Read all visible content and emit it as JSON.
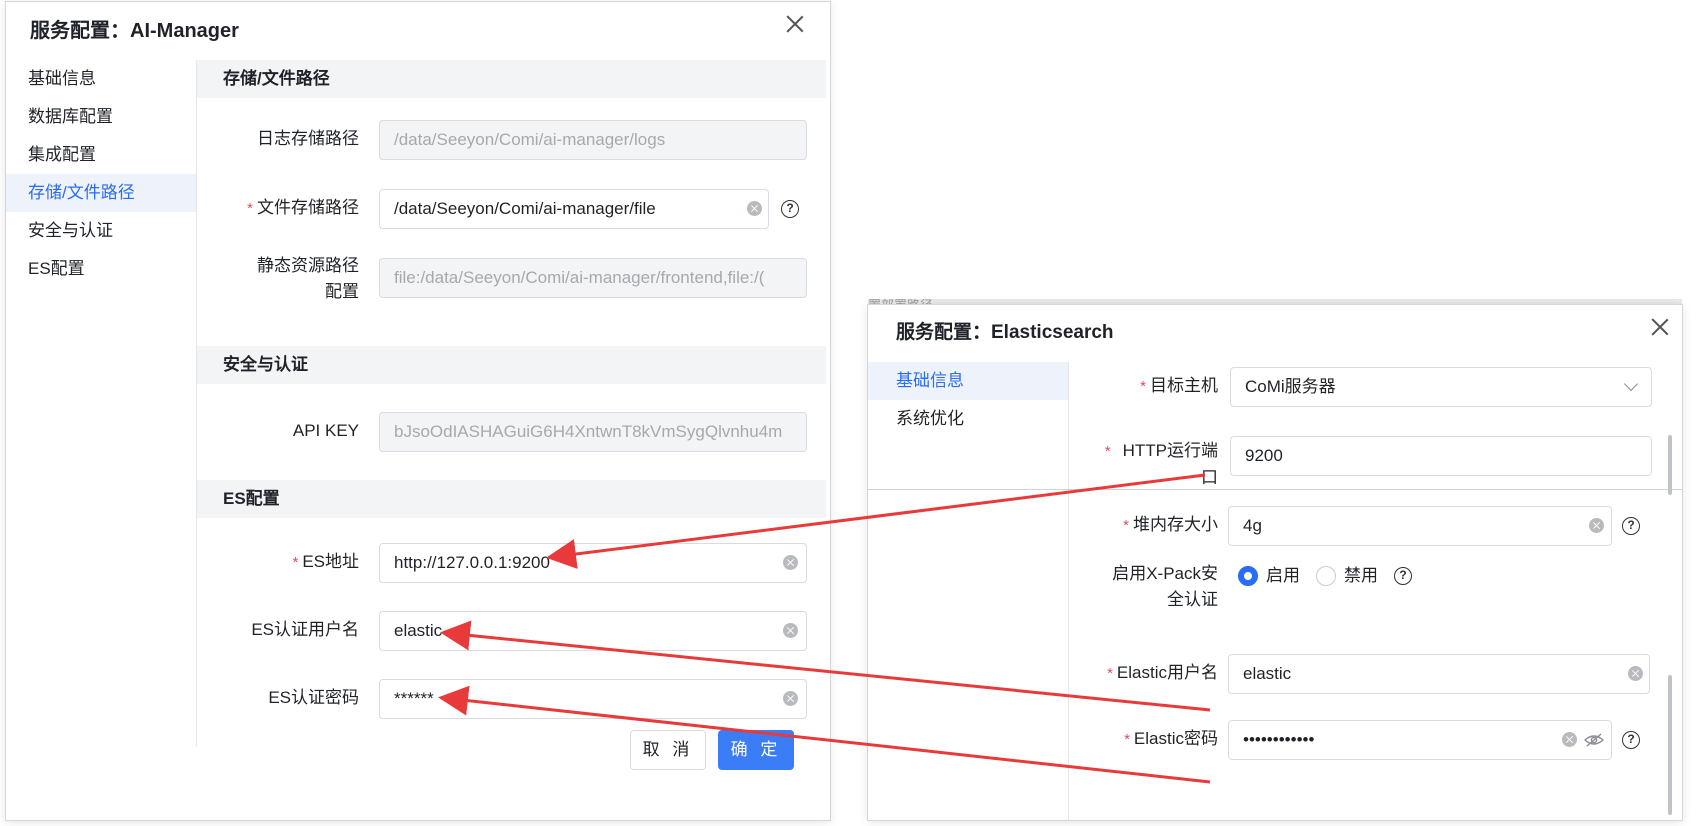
{
  "dialog_a": {
    "title": "服务配置：AI-Manager",
    "nav": [
      "基础信息",
      "数据库配置",
      "集成配置",
      "存储/文件路径",
      "安全与认证",
      "ES配置"
    ],
    "active_nav": "存储/文件路径",
    "sections": {
      "storage": {
        "title": "存储/文件路径",
        "log_path_label": "日志存储路径",
        "log_path_value": "/data/Seeyon/Comi/ai-manager/logs",
        "file_path_label": "文件存储路径",
        "file_path_value": "/data/Seeyon/Comi/ai-manager/file",
        "static_path_label_line1": "静态资源路径",
        "static_path_label_line2": "配置",
        "static_path_value": "file:/data/Seeyon/Comi/ai-manager/frontend,file:/("
      },
      "security": {
        "title": "安全与认证",
        "api_key_label": "API KEY",
        "api_key_value": "bJsoOdIASHAGuiG6H4XntwnT8kVmSygQlvnhu4m"
      },
      "es": {
        "title": "ES配置",
        "address_label": "ES地址",
        "address_value": "http://127.0.0.1:9200",
        "username_label": "ES认证用户名",
        "username_value": "elastic",
        "password_label": "ES认证密码",
        "password_value": "******"
      }
    },
    "buttons": {
      "cancel": "取 消",
      "ok": "确 定"
    }
  },
  "dialog_b": {
    "title": "服务配置：Elasticsearch",
    "nav": [
      "基础信息",
      "系统优化"
    ],
    "active_nav": "基础信息",
    "fields": {
      "target_host_label": "目标主机",
      "target_host_value": "CoMi服务器",
      "http_port_label_line1": "HTTP运行端",
      "http_port_label_line2": "口",
      "http_port_value": "9200",
      "heap_label": "堆内存大小",
      "heap_value": "4g",
      "xpack_label_line1": "启用X-Pack安",
      "xpack_label_line2": "全认证",
      "xpack_options": [
        "启用",
        "禁用"
      ],
      "xpack_selected": "启用",
      "elastic_user_label": "Elastic用户名",
      "elastic_user_value": "elastic",
      "elastic_pass_label": "Elastic密码",
      "elastic_pass_value": "••••••••••••"
    }
  },
  "background_text": "置部署路径",
  "colors": {
    "primary": "#3b7cf7",
    "arrow": "#e83a3a",
    "required": "#e34d59"
  },
  "icons": [
    "close-icon",
    "clear-icon",
    "help-icon",
    "chevron-down-icon",
    "eye-off-icon"
  ]
}
